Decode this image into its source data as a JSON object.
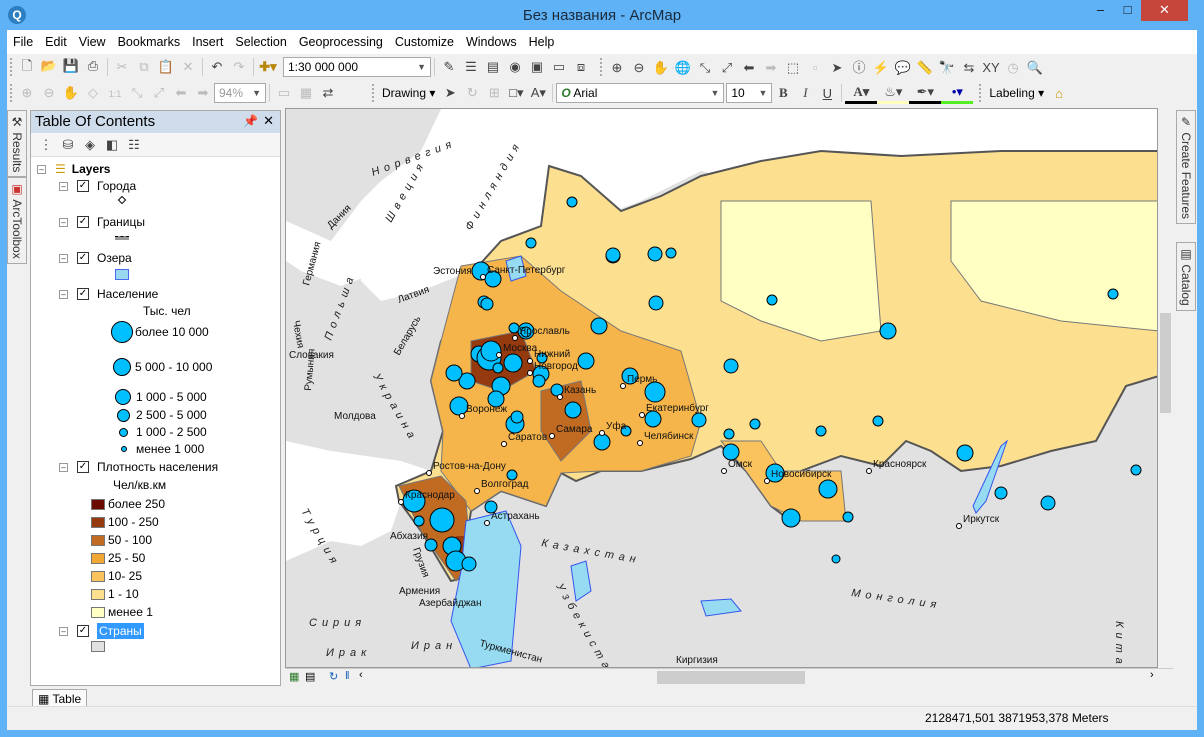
{
  "window": {
    "title": "Без названия - ArcMap",
    "controls": [
      "minimize-icon",
      "maximize-icon",
      "close-icon"
    ]
  },
  "menu": [
    "File",
    "Edit",
    "View",
    "Bookmarks",
    "Insert",
    "Selection",
    "Geoprocessing",
    "Customize",
    "Windows",
    "Help"
  ],
  "toolbar1": {
    "icons_a": [
      "new-document-icon",
      "open-icon",
      "save-icon",
      "print-icon"
    ],
    "icons_b": [
      "cut-icon",
      "copy-icon",
      "paste-icon",
      "delete-icon"
    ],
    "icons_c": [
      "undo-icon",
      "redo-icon"
    ],
    "add_data_icon": "add-data-icon",
    "scale": "1:30 000 000",
    "icons_d": [
      "editor-icon",
      "table-of-contents-icon",
      "catalog-window-icon",
      "search-window-icon",
      "arctoolbox-icon",
      "python-icon",
      "model-builder-icon"
    ],
    "icons_e": [
      "zoom-in-icon",
      "zoom-out-icon",
      "pan-icon",
      "full-extent-icon",
      "fixed-zoom-in-icon",
      "fixed-zoom-out-icon",
      "back-extent-icon",
      "forward-extent-icon",
      "select-features-icon",
      "clear-selection-icon",
      "select-elements-icon",
      "identify-icon",
      "hyperlink-icon",
      "html-popup-icon",
      "measure-icon",
      "find-icon",
      "find-route-icon",
      "go-to-xy-icon",
      "time-slider-icon",
      "magnifier-window-icon"
    ]
  },
  "toolbar2": {
    "icons_a": [
      "layout-zoom-in-icon",
      "layout-zoom-out-icon",
      "layout-pan-icon",
      "zoom-whole-page-icon",
      "zoom-100-icon",
      "layout-fixed-zoom-in-icon",
      "layout-fixed-zoom-out-icon",
      "layout-back-icon",
      "layout-forward-icon"
    ],
    "zoom": "94%",
    "icons_b": [
      "toggle-draft-mode-icon",
      "focus-data-frame-icon",
      "change-layout-icon"
    ],
    "drawing_label": "Drawing",
    "icons_c": [
      "select-elements-icon",
      "rotate-icon",
      "zoom-to-selected-elements-icon",
      "rectangle-icon",
      "text-icon"
    ],
    "font": "Arial",
    "font_size": "10",
    "bold": "B",
    "italic": "I",
    "underline": "U",
    "font_color": "#000000",
    "fill_color": "#ffffc0",
    "line_color": "#000000",
    "marker_color": "#55ee22",
    "labeling_label": "Labeling"
  },
  "dock_left": [
    "Results",
    "ArcToolbox"
  ],
  "dock_right": [
    "Create Features",
    "Catalog"
  ],
  "toc": {
    "title": "Table Of Contents",
    "tools": [
      "list-by-drawing-order-icon",
      "list-by-source-icon",
      "list-by-visibility-icon",
      "list-by-selection-icon",
      "options-icon"
    ],
    "root": "Layers",
    "layers": [
      {
        "name": "Города",
        "checked": true
      },
      {
        "name": "Границы",
        "checked": true
      },
      {
        "name": "Озера",
        "checked": true,
        "color": "#9ad8f0"
      },
      {
        "name": "Население",
        "checked": true,
        "unit": "Тыс. чел",
        "classes": [
          "более 10 000",
          "5 000 - 10 000",
          "1 000 - 5 000",
          "2 500 - 5 000",
          "1 000 - 2 500",
          "менее 1 000"
        ],
        "color": "#00bfff"
      },
      {
        "name": "Плотность населения",
        "checked": true,
        "unit": "Чел/кв.км",
        "classes": [
          {
            "label": "более 250",
            "color": "#6b0a00"
          },
          {
            "label": "100 - 250",
            "color": "#953a0e"
          },
          {
            "label": "50 - 100",
            "color": "#c06a22"
          },
          {
            "label": "25 - 50",
            "color": "#f1a733"
          },
          {
            "label": "10- 25",
            "color": "#fbc35d"
          },
          {
            "label": "1 - 10",
            "color": "#fde08f"
          },
          {
            "label": "менее 1",
            "color": "#ffffc4"
          }
        ]
      },
      {
        "name": "Страны",
        "checked": true,
        "selected": true,
        "color": "#e1e1e1"
      }
    ]
  },
  "map": {
    "cities": [
      "Санкт-Петербург",
      "Ярославль",
      "Москва",
      "Нижний",
      "Новгород",
      "Казань",
      "Пермь",
      "Екатеринбург",
      "Воронеж",
      "Самара",
      "Уфа",
      "Саратов",
      "Челябинск",
      "Ростов-на-Дону",
      "Волгоград",
      "Краснодар",
      "Астрахань",
      "Омск",
      "Новосибирск",
      "Красноярск",
      "Иркутск"
    ],
    "countries": [
      "Норвегия",
      "Швеция",
      "Финляндия",
      "Германия",
      "Дания",
      "Эстония",
      "Латвия",
      "Польша",
      "Чехия",
      "Беларусь",
      "Словакия",
      "Украина",
      "Молдова",
      "Румыния",
      "Абхазия",
      "Грузия",
      "Армения",
      "Азербайджан",
      "Турция",
      "Сирия",
      "Ирак",
      "Иран",
      "Туркменистан",
      "Узбекистан",
      "Казахстан",
      "Киргизия",
      "Монголия",
      "Китай"
    ]
  },
  "bottom_tab": "Table",
  "status": {
    "coordinates": "2128471,501  3871953,378 Meters"
  }
}
